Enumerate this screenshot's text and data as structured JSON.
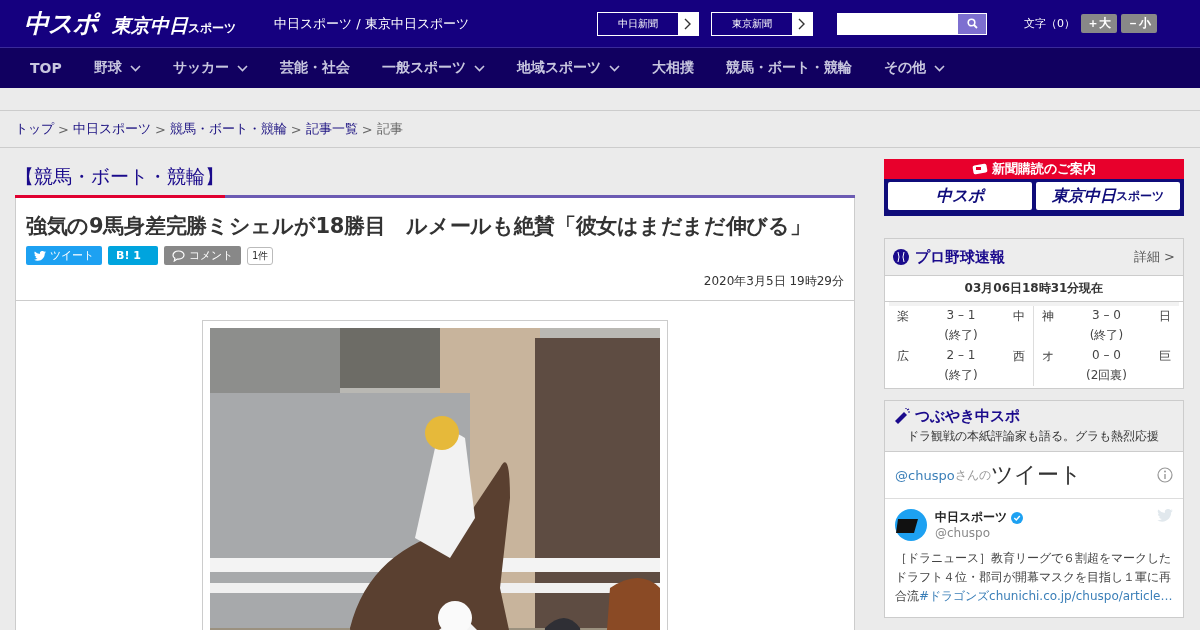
{
  "header": {
    "logo_main": "中スポ",
    "logo_sub": "東京中日",
    "logo_sub_small": "スポーツ",
    "site_name": "中日スポーツ / 東京中日スポーツ",
    "links": [
      {
        "label": "中日新聞"
      },
      {
        "label": "東京新聞"
      }
    ],
    "text_size": {
      "label": "文字（0）",
      "buttons": [
        "＋大",
        "－小"
      ]
    }
  },
  "nav": [
    {
      "label": "TOP",
      "dropdown": false
    },
    {
      "label": "野球",
      "dropdown": true
    },
    {
      "label": "サッカー",
      "dropdown": true
    },
    {
      "label": "芸能・社会",
      "dropdown": false
    },
    {
      "label": "一般スポーツ",
      "dropdown": true
    },
    {
      "label": "地域スポーツ",
      "dropdown": true
    },
    {
      "label": "大相撲",
      "dropdown": false
    },
    {
      "label": "競馬・ボート・競輪",
      "dropdown": false
    },
    {
      "label": "その他",
      "dropdown": true
    }
  ],
  "breadcrumb_separator": ">",
  "breadcrumb": [
    {
      "label": "トップ",
      "link": true
    },
    {
      "label": "中日スポーツ",
      "link": true
    },
    {
      "label": "競馬・ボート・競輪",
      "link": true
    },
    {
      "label": "記事一覧",
      "link": true
    },
    {
      "label": "記事",
      "link": false
    }
  ],
  "category": "【競馬・ボート・競輪】",
  "article": {
    "title": "強気の9馬身差完勝ミシェルが18勝目　ルメールも絶賛「彼女はまだまだ伸びる」",
    "share": {
      "tweet": "ツイート",
      "hatena": "B!",
      "hatena_count": "1",
      "comment": "コメント",
      "comment_count": "1件"
    },
    "date": "2020年3月5日 19時29分"
  },
  "sidebar": {
    "subscribe": {
      "title": "新聞購読のご案内",
      "logos": [
        "中スポ",
        "東京中日"
      ],
      "logo_small": "スポーツ"
    },
    "baseball": {
      "title": "プロ野球速報",
      "more": "詳細 >",
      "updated": "03月06日18時31分現在",
      "games": [
        {
          "team1": "楽",
          "score": "3 – 1",
          "team2": "中",
          "status": "(終了)"
        },
        {
          "team1": "神",
          "score": "3 – 0",
          "team2": "日",
          "status": "(終了)"
        },
        {
          "team1": "広",
          "score": "2 – 1",
          "team2": "西",
          "status": "(終了)"
        },
        {
          "team1": "オ",
          "score": "0 – 0",
          "team2": "巨",
          "status": "(2回裏)"
        }
      ]
    },
    "tweets": {
      "title": "つぶやき中スポ",
      "subtitle": "ドラ観戦の本紙評論家も語る。グラも熱烈応援",
      "handle": "@chuspo",
      "handle_suffix": "さんの",
      "heading": "ツイート",
      "tweet": {
        "name": "中日スポーツ",
        "handle": "@chuspo",
        "text": "［ドラニュース］教育リーグで６割超をマークしたドラフト４位・郡司が開幕マスクを目指し１軍に再合流",
        "hashtag": "#ドラゴンズ",
        "link": "chunichi.co.jp/chuspo/article…"
      }
    }
  }
}
